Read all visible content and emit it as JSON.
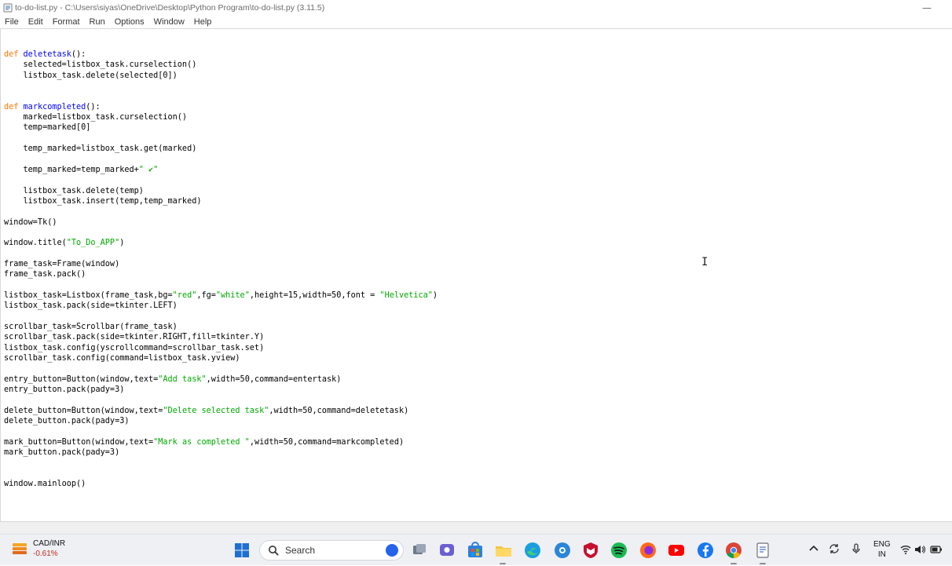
{
  "window": {
    "title": "to-do-list.py - C:\\Users\\siyas\\OneDrive\\Desktop\\Python Program\\to-do-list.py (3.11.5)",
    "minimize_glyph": "—"
  },
  "menu": [
    "File",
    "Edit",
    "Format",
    "Run",
    "Options",
    "Window",
    "Help"
  ],
  "colors": {
    "keyword": "#ff7700",
    "defname": "#0000ff",
    "string": "#00aa00",
    "plain": "#000000"
  },
  "code_lines": [
    [
      {
        "t": "def ",
        "c": "kw"
      },
      {
        "t": "deletetask",
        "c": "def"
      },
      {
        "t": "():",
        "c": ""
      }
    ],
    [
      {
        "t": "    selected=listbox_task.curselection()",
        "c": ""
      }
    ],
    [
      {
        "t": "    listbox_task.delete(selected[0])",
        "c": ""
      }
    ],
    [],
    [],
    [
      {
        "t": "def ",
        "c": "kw"
      },
      {
        "t": "markcompleted",
        "c": "def"
      },
      {
        "t": "():",
        "c": ""
      }
    ],
    [
      {
        "t": "    marked=listbox_task.curselection()",
        "c": ""
      }
    ],
    [
      {
        "t": "    temp=marked[0]",
        "c": ""
      }
    ],
    [],
    [
      {
        "t": "    temp_marked=listbox_task.get(marked)",
        "c": ""
      }
    ],
    [],
    [
      {
        "t": "    temp_marked=temp_marked+",
        "c": ""
      },
      {
        "t": "\" ",
        "c": "str"
      },
      {
        "t": "✔",
        "c": "check"
      },
      {
        "t": "\"",
        "c": "str"
      }
    ],
    [],
    [
      {
        "t": "    listbox_task.delete(temp)",
        "c": ""
      }
    ],
    [
      {
        "t": "    listbox_task.insert(temp,temp_marked)",
        "c": ""
      }
    ],
    [],
    [
      {
        "t": "window=Tk()",
        "c": ""
      }
    ],
    [],
    [
      {
        "t": "window.title(",
        "c": ""
      },
      {
        "t": "\"To_Do_APP\"",
        "c": "str"
      },
      {
        "t": ")",
        "c": ""
      }
    ],
    [],
    [
      {
        "t": "frame_task=Frame(window)",
        "c": ""
      }
    ],
    [
      {
        "t": "frame_task.pack()",
        "c": ""
      }
    ],
    [],
    [
      {
        "t": "listbox_task=Listbox(frame_task,bg=",
        "c": ""
      },
      {
        "t": "\"red\"",
        "c": "str"
      },
      {
        "t": ",fg=",
        "c": ""
      },
      {
        "t": "\"white\"",
        "c": "str"
      },
      {
        "t": ",height=15,width=50,font = ",
        "c": ""
      },
      {
        "t": "\"Helvetica\"",
        "c": "str"
      },
      {
        "t": ")",
        "c": ""
      }
    ],
    [
      {
        "t": "listbox_task.pack(side=tkinter.LEFT)",
        "c": ""
      }
    ],
    [],
    [
      {
        "t": "scrollbar_task=Scrollbar(frame_task)",
        "c": ""
      }
    ],
    [
      {
        "t": "scrollbar_task.pack(side=tkinter.RIGHT,fill=tkinter.Y)",
        "c": ""
      }
    ],
    [
      {
        "t": "listbox_task.config(yscrollcommand=scrollbar_task.set)",
        "c": ""
      }
    ],
    [
      {
        "t": "scrollbar_task.config(command=listbox_task.yview)",
        "c": ""
      }
    ],
    [],
    [
      {
        "t": "entry_button=Button(window,text=",
        "c": ""
      },
      {
        "t": "\"Add task\"",
        "c": "str"
      },
      {
        "t": ",width=50,command=entertask)",
        "c": ""
      }
    ],
    [
      {
        "t": "entry_button.pack(pady=3)",
        "c": ""
      }
    ],
    [],
    [
      {
        "t": "delete_button=Button(window,text=",
        "c": ""
      },
      {
        "t": "\"Delete selected task\"",
        "c": "str"
      },
      {
        "t": ",width=50,command=deletetask)",
        "c": ""
      }
    ],
    [
      {
        "t": "delete_button.pack(pady=3)",
        "c": ""
      }
    ],
    [],
    [
      {
        "t": "mark_button=Button(window,text=",
        "c": ""
      },
      {
        "t": "\"Mark as completed \"",
        "c": "str"
      },
      {
        "t": ",width=50,command=markcompleted)",
        "c": ""
      }
    ],
    [
      {
        "t": "mark_button.pack(pady=3)",
        "c": ""
      }
    ],
    [],
    [],
    [
      {
        "t": "window.mainloop()",
        "c": ""
      }
    ]
  ],
  "taskbar": {
    "ticker_name": "CAD/INR",
    "ticker_change": "-0.61%",
    "search_label": "Search",
    "lang_line1": "ENG",
    "lang_line2": "IN",
    "pinned_apps": [
      "windows-start",
      "search",
      "bing",
      "task-view",
      "teams-chat",
      "microsoft-store",
      "file-explorer",
      "edge",
      "settings",
      "mcafee",
      "spotify",
      "firefox",
      "youtube",
      "facebook",
      "chrome",
      "notepad"
    ]
  }
}
